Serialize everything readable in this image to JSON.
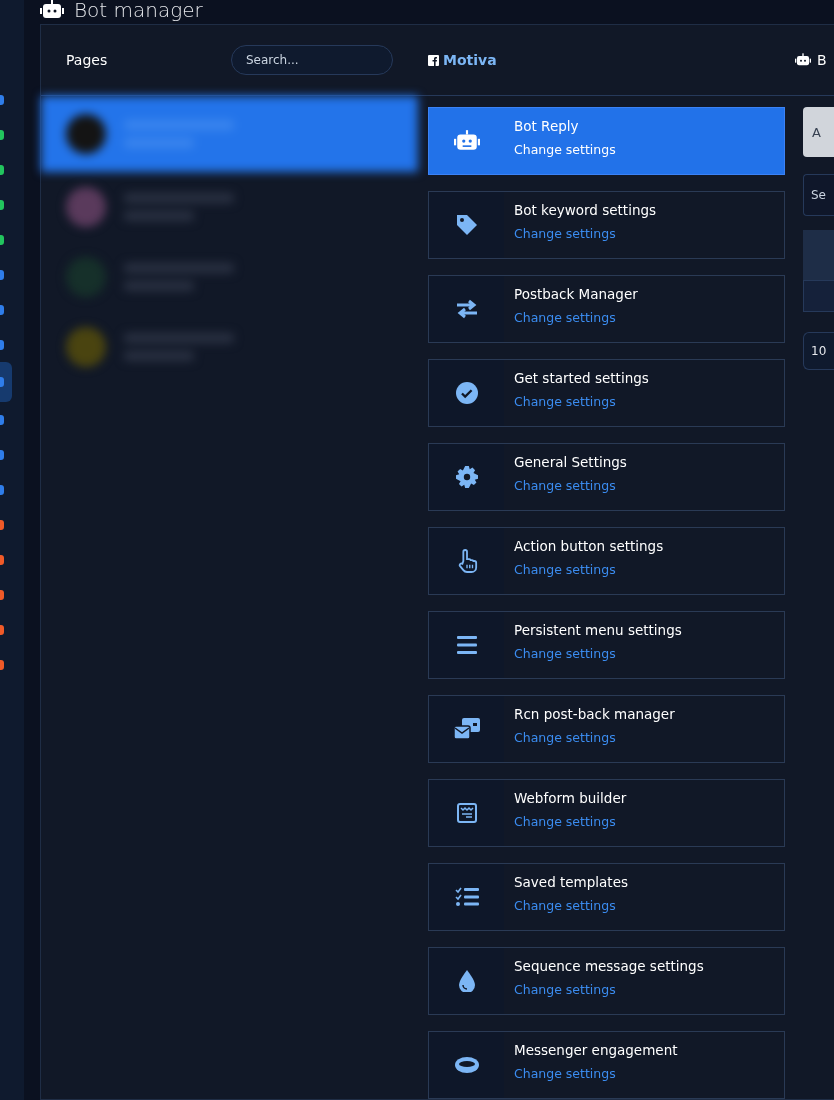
{
  "page_title": "Bot manager",
  "pages_panel": {
    "title": "Pages",
    "search": {
      "placeholder": "Search..."
    },
    "pages": [
      {
        "selected": true,
        "color": "#141414"
      },
      {
        "selected": false,
        "color": "#5a3a5c"
      },
      {
        "selected": false,
        "color": "#16302a"
      },
      {
        "selected": false,
        "color": "#4a4410"
      }
    ]
  },
  "page_name": "Motiva",
  "right_header": "B",
  "menu": [
    {
      "kind": "robot",
      "title": "Bot Reply",
      "link": "Change settings",
      "selected": true
    },
    {
      "kind": "tag",
      "title": "Bot keyword settings",
      "link": "Change settings",
      "selected": false
    },
    {
      "kind": "exchange",
      "title": "Postback Manager",
      "link": "Change settings",
      "selected": false
    },
    {
      "kind": "check",
      "title": "Get started settings",
      "link": "Change settings",
      "selected": false
    },
    {
      "kind": "gear",
      "title": "General Settings",
      "link": "Change settings",
      "selected": false
    },
    {
      "kind": "hand",
      "title": "Action button settings",
      "link": "Change settings",
      "selected": false
    },
    {
      "kind": "bars",
      "title": "Persistent menu settings",
      "link": "Change settings",
      "selected": false
    },
    {
      "kind": "mail",
      "title": "Rcn post-back manager",
      "link": "Change settings",
      "selected": false
    },
    {
      "kind": "form",
      "title": "Webform builder",
      "link": "Change settings",
      "selected": false
    },
    {
      "kind": "list",
      "title": "Saved templates",
      "link": "Change settings",
      "selected": false
    },
    {
      "kind": "drop",
      "title": "Sequence message settings",
      "link": "Change settings",
      "selected": false
    },
    {
      "kind": "ring",
      "title": "Messenger engagement",
      "link": "Change settings",
      "selected": false
    }
  ],
  "right_panel": {
    "button": "A",
    "select": "Se",
    "page_size": "10"
  }
}
